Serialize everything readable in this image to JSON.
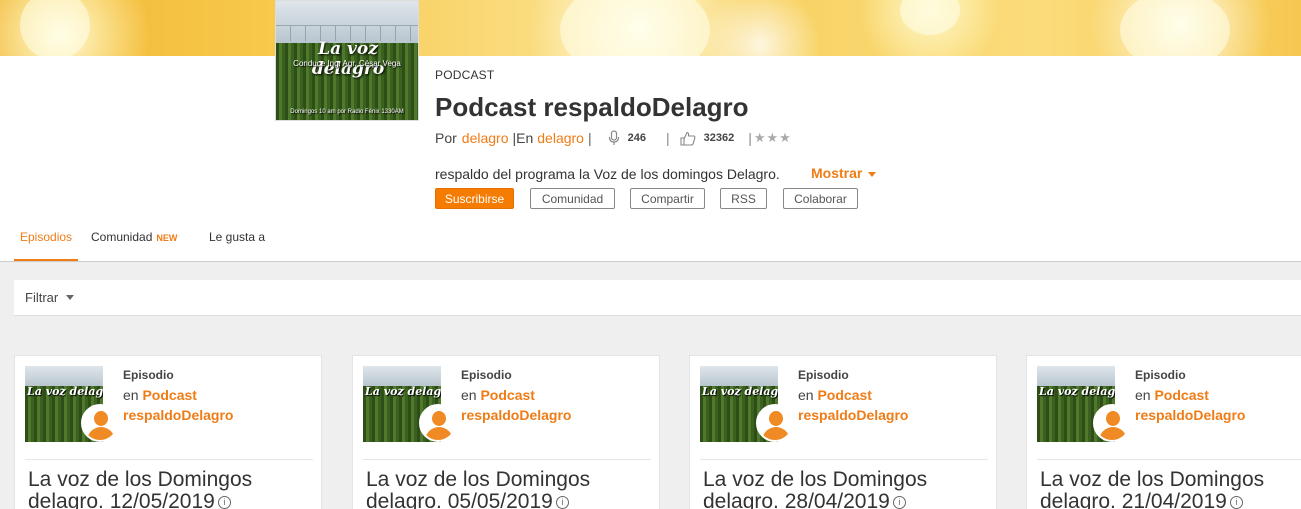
{
  "cover": {
    "title": "La voz delagro",
    "subtitle": "Conduce Ing. Agr. César Vega",
    "footer": "Domingos 10 am por Radio Fénix 1330AM"
  },
  "header": {
    "type_label": "PODCAST",
    "title": "Podcast respaldoDelagro",
    "by_label": "Por",
    "by_link": "delagro",
    "in_label": "|En",
    "in_link": "delagro",
    "separator": "|",
    "episodes_count": "246",
    "likes_count": "32362",
    "rating_sep": "|",
    "stars": "★★★",
    "description": "respaldo del programa la Voz de los domingos Delagro.",
    "show_more": "Mostrar"
  },
  "buttons": {
    "subscribe": "Suscribirse",
    "community": "Comunidad",
    "share": "Compartir",
    "rss": "RSS",
    "collaborate": "Colaborar"
  },
  "tabs": {
    "episodes": "Episodios",
    "community": "Comunidad",
    "new_badge": "NEW",
    "likes": "Le gusta a"
  },
  "filter": {
    "label": "Filtrar"
  },
  "episodes": [
    {
      "type": "Episodio",
      "en": "en",
      "podcast_prefix": "Podcast",
      "podcast_name": "respaldoDelagro",
      "thumb_title": "La voz delagro",
      "title": "La voz de los Domingos delagro. 12/05/2019"
    },
    {
      "type": "Episodio",
      "en": "en",
      "podcast_prefix": "Podcast",
      "podcast_name": "respaldoDelagro",
      "thumb_title": "La voz delagro",
      "title": "La voz de los Domingos delagro. 05/05/2019"
    },
    {
      "type": "Episodio",
      "en": "en",
      "podcast_prefix": "Podcast",
      "podcast_name": "respaldoDelagro",
      "thumb_title": "La voz delagro",
      "title": "La voz de los Domingos delagro. 28/04/2019"
    },
    {
      "type": "Episodio",
      "en": "en",
      "podcast_prefix": "Podcast",
      "podcast_name": "respaldoDelagro",
      "thumb_title": "La voz delagro",
      "title": "La voz de los Domingos delagro. 21/04/2019"
    }
  ],
  "colors": {
    "accent": "#f07c16",
    "subscribe_bg": "#f57c00",
    "content_bg": "#efefef"
  },
  "icons": {
    "episodes": "microphone-icon",
    "likes": "thumbs-up-icon",
    "info": "info-icon"
  }
}
